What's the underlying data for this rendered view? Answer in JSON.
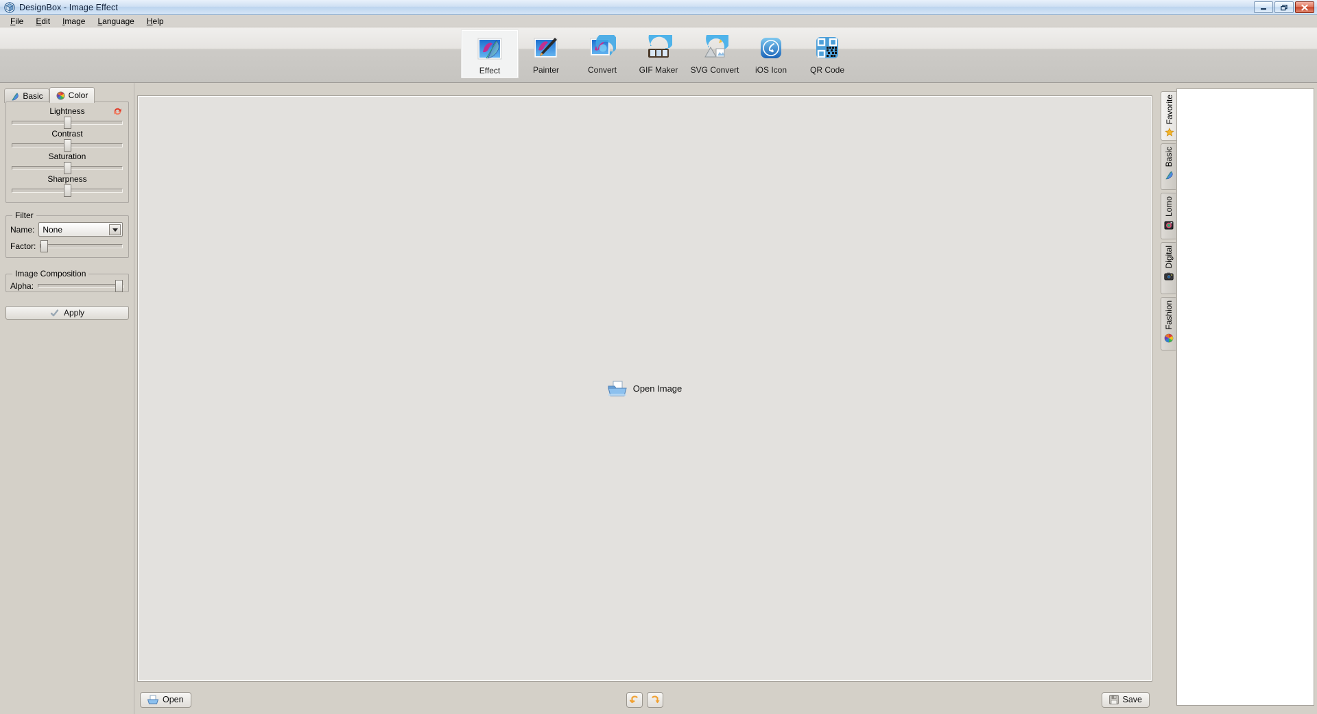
{
  "window": {
    "title": "DesignBox - Image Effect",
    "app_icon": "app-logo-icon",
    "buttons": {
      "minimize": "–",
      "restore": "❐",
      "close": "✕"
    }
  },
  "menubar": {
    "items": [
      {
        "label": "File",
        "mnemonic": "F"
      },
      {
        "label": "Edit",
        "mnemonic": "E"
      },
      {
        "label": "Image",
        "mnemonic": "I"
      },
      {
        "label": "Language",
        "mnemonic": "L"
      },
      {
        "label": "Help",
        "mnemonic": "H"
      }
    ]
  },
  "toolbar": {
    "selected": "Effect",
    "items": [
      {
        "label": "Effect",
        "icon": "feather-photo-icon"
      },
      {
        "label": "Painter",
        "icon": "paintbrush-photo-icon"
      },
      {
        "label": "Convert",
        "icon": "convert-photo-icon"
      },
      {
        "label": "GIF Maker",
        "icon": "filmstrip-gif-icon"
      },
      {
        "label": "SVG Convert",
        "icon": "svg-convert-icon"
      },
      {
        "label": "iOS Icon",
        "icon": "ios-icon-icon"
      },
      {
        "label": "QR Code",
        "icon": "qr-code-icon"
      }
    ]
  },
  "left_panel": {
    "tabs": [
      {
        "label": "Basic",
        "icon": "feather-icon",
        "active": false
      },
      {
        "label": "Color",
        "icon": "color-wheel-icon",
        "active": true
      }
    ],
    "sliders": [
      {
        "label": "Lightness",
        "value_pct": 50,
        "has_reset": true,
        "reset_icon": "reset-arrows-icon"
      },
      {
        "label": "Contrast",
        "value_pct": 50,
        "has_reset": false
      },
      {
        "label": "Saturation",
        "value_pct": 50,
        "has_reset": false
      },
      {
        "label": "Sharpness",
        "value_pct": 50,
        "has_reset": false
      }
    ],
    "filter": {
      "legend": "Filter",
      "name_label": "Name:",
      "name_value": "None",
      "name_options": [
        "None"
      ],
      "factor_label": "Factor:",
      "factor_pct": 2
    },
    "composition": {
      "legend": "Image Composition",
      "alpha_label": "Alpha:",
      "alpha_pct": 100
    },
    "apply": {
      "label": "Apply",
      "icon": "check-icon"
    }
  },
  "canvas": {
    "open_image": {
      "label": "Open Image",
      "icon": "open-folder-image-icon"
    }
  },
  "bottombar": {
    "open": {
      "label": "Open",
      "icon": "open-folder-icon"
    },
    "undo": {
      "label": "",
      "icon": "undo-arrow-icon"
    },
    "redo": {
      "label": "",
      "icon": "redo-arrow-icon"
    },
    "save": {
      "label": "Save",
      "icon": "floppy-disk-icon"
    }
  },
  "right_tabs": {
    "active": "Favorite",
    "items": [
      {
        "label": "Favorite",
        "icon": "star-icon"
      },
      {
        "label": "Basic",
        "icon": "feather-icon"
      },
      {
        "label": "Lomo",
        "icon": "lomo-camera-icon"
      },
      {
        "label": "Digital",
        "icon": "digital-camera-icon"
      },
      {
        "label": "Fashion",
        "icon": "fashion-palette-icon"
      }
    ]
  },
  "colors": {
    "titlebar_start": "#e8f1fb",
    "titlebar_end": "#bcd4ee",
    "window_bg": "#d4d0c8",
    "canvas_bg": "#e3e1de",
    "close_button": "#c8452a",
    "accent_orange": "#f0a030"
  }
}
